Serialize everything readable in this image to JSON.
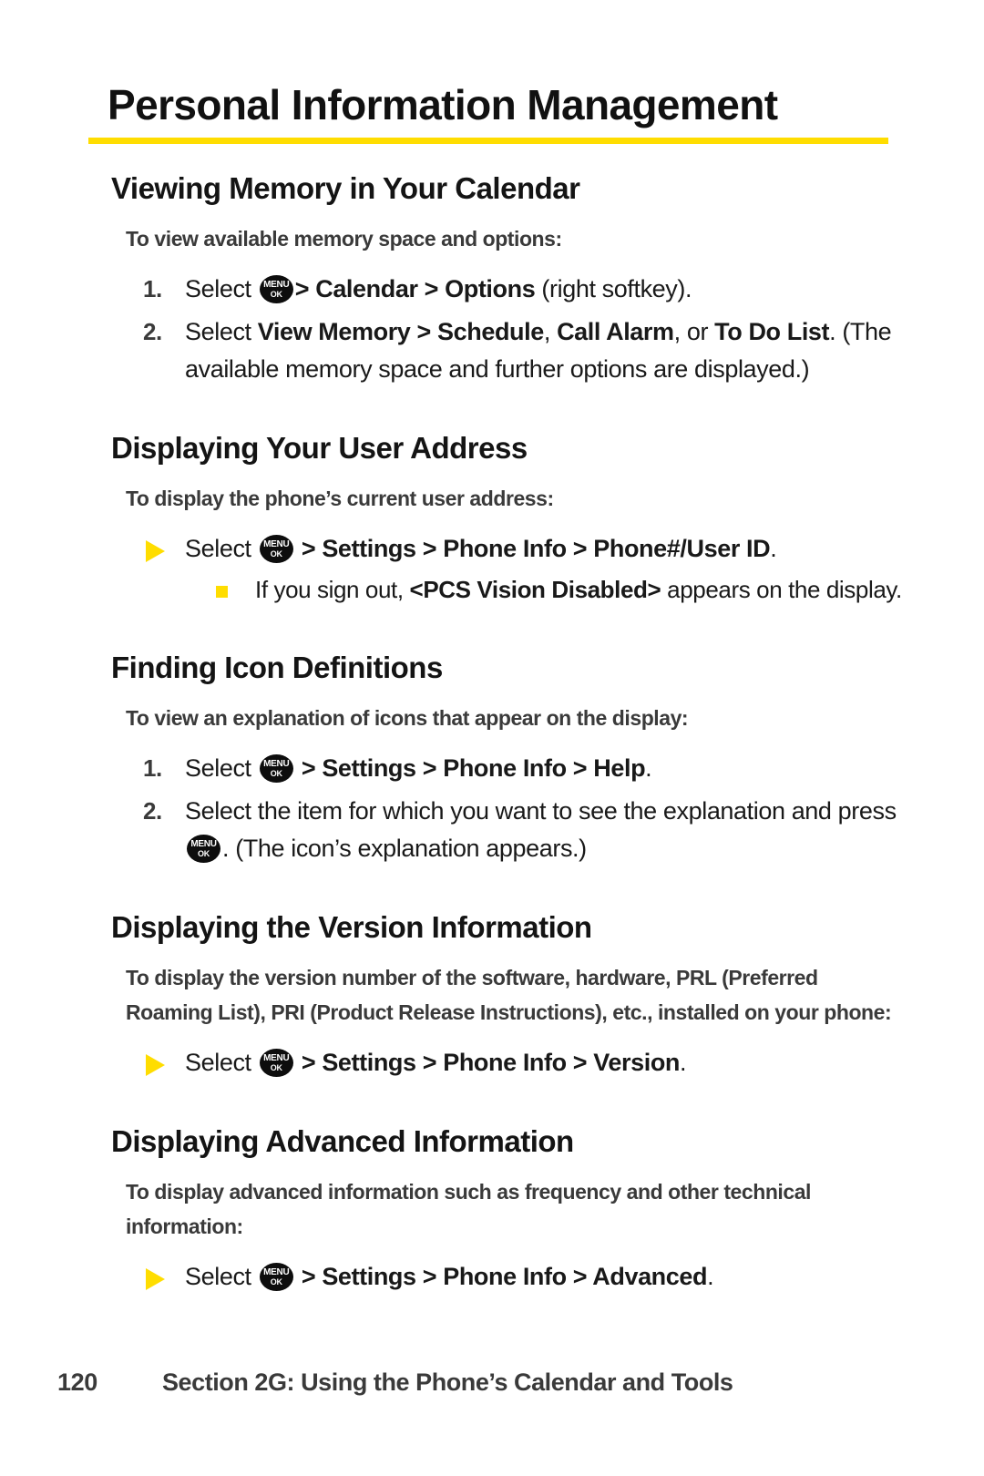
{
  "page": {
    "title": "Personal Information Management",
    "rule_color": "#FFDD00",
    "number": "120",
    "footer_text": "Section 2G: Using the Phone’s Calendar and Tools"
  },
  "menu_key": {
    "line1": "MENU",
    "line2": "OK",
    "name": "menu-ok-key-icon"
  },
  "sections": [
    {
      "heading": "Viewing Memory in Your Calendar",
      "lead": "To view available memory space and options:",
      "steps": [
        {
          "num": "1.",
          "text_before": "Select ",
          "after_key_bold": "> Calendar > Options",
          "text_after": " (right softkey)."
        },
        {
          "num": "2.",
          "text": "Select View Memory > Schedule, Call Alarm, or To Do List. (The available memory space and further options are displayed.)"
        }
      ]
    },
    {
      "heading": "Displaying Your User Address",
      "lead": "To display the phone’s current user address:",
      "arrow": {
        "text_before": "Select ",
        "path": "> Settings > Phone Info > Phone#/User ID",
        "text_after": "."
      },
      "sub": {
        "text_before": "If you sign out, ",
        "bold": "<PCS Vision Disabled>",
        "text_after": " appears on the display."
      }
    },
    {
      "heading": "Finding Icon Definitions",
      "lead": "To view an explanation of icons that appear on the display:",
      "steps": [
        {
          "num": "1.",
          "text_before": "Select ",
          "path": "> Settings > Phone Info > Help",
          "text_after": "."
        },
        {
          "num": "2.",
          "text_before": "Select the item for which you want to see the explanation and press ",
          "text_after": ". (The icon’s explanation appears.)"
        }
      ]
    },
    {
      "heading": "Displaying the Version Information",
      "lead": "To display the version number of the software, hardware, PRL (Preferred Roaming List), PRI (Product Release Instructions), etc., installed on your phone:",
      "arrow": {
        "text_before": "Select ",
        "path": "> Settings > Phone Info > Version",
        "text_after": "."
      }
    },
    {
      "heading": "Displaying Advanced Information",
      "lead": "To display advanced information such as frequency and other technical information:",
      "arrow": {
        "text_before": "Select ",
        "path": "> Settings > Phone Info > Advanced",
        "text_after": "."
      }
    }
  ]
}
